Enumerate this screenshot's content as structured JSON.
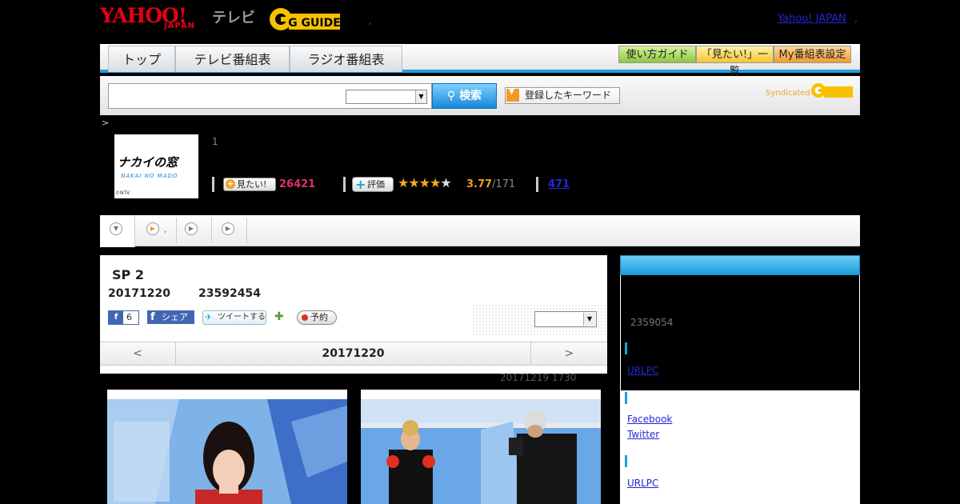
{
  "header": {
    "logo_yahoo": "YAHOO!",
    "logo_japan": "JAPAN",
    "logo_tv": "テレビ",
    "logo_gguide": "G GUIDE",
    "yahoo_link": "Yahoo! JAPAN",
    "yahoo_link_suffix": ","
  },
  "nav": {
    "tabs": [
      {
        "label": "トップ"
      },
      {
        "label": "テレビ番組表"
      },
      {
        "label": "ラジオ番組表"
      }
    ],
    "buttons": [
      {
        "label": "使い方ガイド"
      },
      {
        "label": "「見たい!」一覧"
      },
      {
        "label": "My番組表設定"
      }
    ]
  },
  "search": {
    "value": "",
    "select_value": "",
    "button_label": "検索",
    "keyword_button_label": "登録したキーワード",
    "syndicated_label": "Syndicated"
  },
  "breadcrumb": ">",
  "program": {
    "logo_text": "ナカイの窓",
    "logo_subtext": "NAKAI NO MADO",
    "logo_copyright": "©NTV",
    "episode_number": "1",
    "mitai_label": "見たい!",
    "mitai_count": "26421",
    "rate_label": "評価",
    "rating": 3.77,
    "rating_text": "3.77",
    "rating_count": "/171",
    "review_count": "471"
  },
  "tabs": {
    "tab2_suffix": ","
  },
  "episode": {
    "title": "SP 2",
    "date": "20171220",
    "view_count": "23592454",
    "fb_like_count": "6",
    "fb_share_label": "シェア",
    "tweet_label": "ツイートする",
    "reserve_label": "予約",
    "select_value": "",
    "date_prev": "<",
    "date_current": "20171220",
    "date_next": ">",
    "updated": "20171219  1730"
  },
  "sidebar": {
    "count": "2359054",
    "link1": "URLPC",
    "facebook_link": "Facebook",
    "twitter_link": "Twitter",
    "link2": "URLPC"
  },
  "colors": {
    "accent_blue": "#1fa0e0",
    "pink_count": "#e0306a",
    "rating_orange": "#f29c1f",
    "yahoo_red": "#e60012"
  }
}
